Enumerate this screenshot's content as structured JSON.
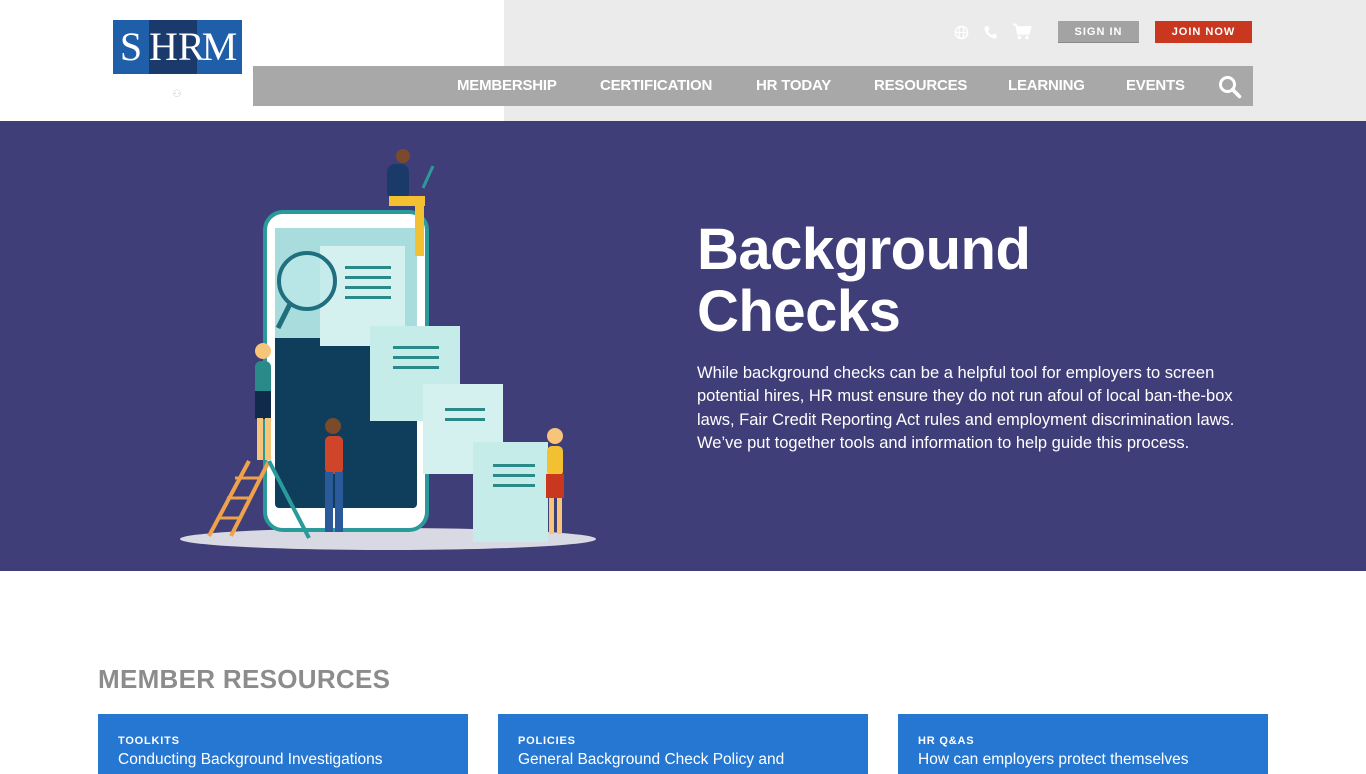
{
  "logo": {
    "seg1": "S",
    "seg2": "HR",
    "seg3": "M"
  },
  "utility": {
    "icons": [
      "globe-icon",
      "phone-icon",
      "cart-icon"
    ],
    "sign_in": "SIGN IN",
    "join_now": "JOIN NOW"
  },
  "nav": {
    "items": [
      "MEMBERSHIP",
      "CERTIFICATION",
      "HR TODAY",
      "RESOURCES",
      "LEARNING",
      "EVENTS"
    ],
    "search_icon": "search-icon"
  },
  "hero": {
    "title_line1": "Background",
    "title_line2": "Checks",
    "description": "While background checks can be a helpful tool for employers to screen potential hires, HR must ensure they do not run afoul of local ban-the-box laws, Fair Credit Reporting Act rules and employment discrimination laws. We’ve put together tools and information to help guide this process."
  },
  "member_resources": {
    "title": "MEMBER RESOURCES",
    "cards": [
      {
        "tag": "TOOLKITS",
        "title": "Conducting Background Investigations"
      },
      {
        "tag": "POLICIES",
        "title": "General Background Check Policy and"
      },
      {
        "tag": "HR Q&AS",
        "title": "How can employers protect themselves"
      }
    ]
  },
  "colors": {
    "hero_bg": "#403e78",
    "card_bg": "#2577d1",
    "join_bg": "#c9371f",
    "nav_bg": "#a8a8a8",
    "logo_blue": "#1f5ea8"
  }
}
